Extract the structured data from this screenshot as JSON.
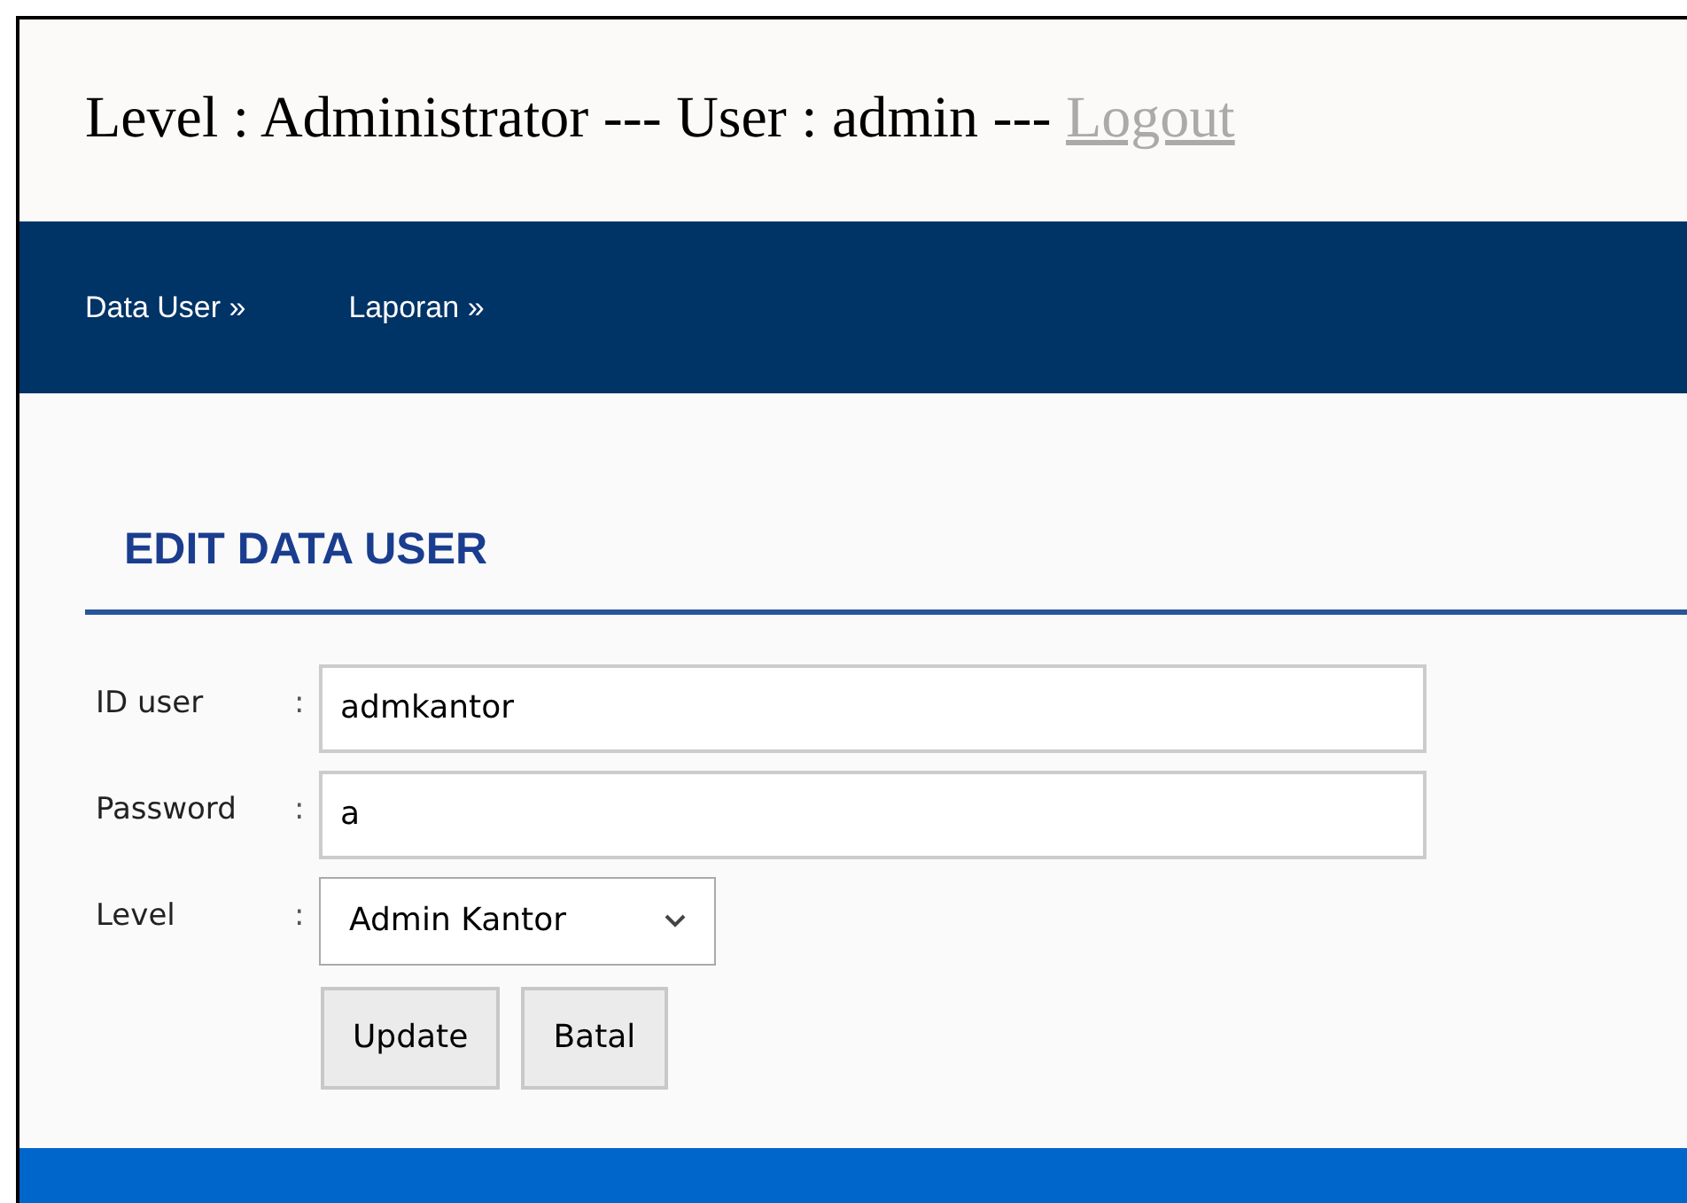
{
  "header": {
    "text": "Level : Administrator --- User : admin --- ",
    "logout": "Logout"
  },
  "nav": [
    {
      "label": "Data User »"
    },
    {
      "label": "Laporan »"
    }
  ],
  "form": {
    "title": "EDIT DATA USER",
    "fields": [
      {
        "kind": "text",
        "label": "ID user",
        "colon": ":",
        "value": "admkantor"
      },
      {
        "kind": "text",
        "label": "Password",
        "colon": ":",
        "value": "a"
      },
      {
        "kind": "select",
        "label": "Level",
        "colon": ":",
        "value": "Admin Kantor"
      }
    ],
    "buttons": [
      "Update",
      "Batal"
    ]
  }
}
